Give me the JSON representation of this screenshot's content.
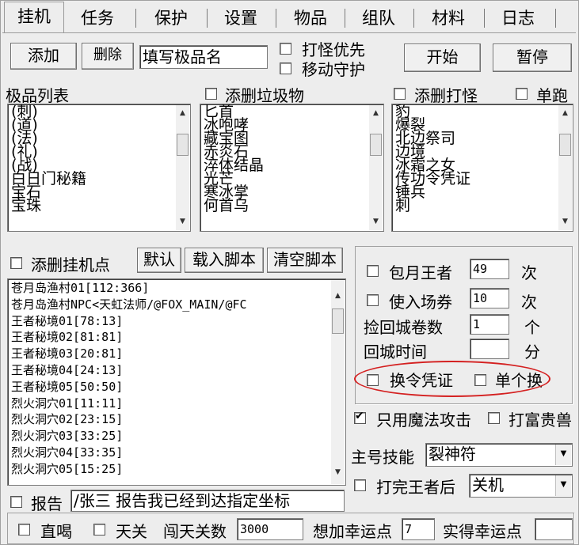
{
  "tabs": [
    "挂机",
    "任务",
    "保护",
    "设置",
    "物品",
    "组队",
    "材料",
    "日志"
  ],
  "toolbar": {
    "add_label": "添加",
    "delete_label": "删除",
    "item_name_value": "填写极品名",
    "monster_priority_label": "打怪优先",
    "move_protect_label": "移动守护",
    "start_label": "开始",
    "pause_label": "暂停"
  },
  "lists": {
    "best_title": "极品列表",
    "best_items": [
      "(刺)",
      "(道)",
      "(法)",
      "(礼)",
      "(战)",
      "白日门秘籍",
      "宝石",
      "宝珠"
    ],
    "junk_title": "添删垃圾物",
    "junk_items": [
      "匕首",
      "冰咆哮",
      "藏宝图",
      "赤炎石",
      "淬体结晶",
      "光芒",
      "寒冰掌",
      "何首乌"
    ],
    "monster_title": "添删打怪",
    "solo_label": "单跑",
    "monster_items": [
      "豹",
      "爆裂",
      "北边祭司",
      "边境",
      "冰霜之女",
      "传功令凭证",
      "锤兵",
      "刺"
    ]
  },
  "script": {
    "add_point_label": "添删挂机点",
    "default_label": "默认",
    "load_label": "载入脚本",
    "clear_label": "清空脚本",
    "points": [
      "苍月岛渔村01[112:366]",
      "苍月岛渔村NPC<天虹法师/@FOX_MAIN/@FC",
      "王者秘境01[78:13]",
      "王者秘境02[81:81]",
      "王者秘境03[20:81]",
      "王者秘境04[24:13]",
      "王者秘境05[50:50]",
      "烈火洞穴01[11:11]",
      "烈火洞穴02[23:15]",
      "烈火洞穴03[33:25]",
      "烈火洞穴04[33:35]",
      "烈火洞穴05[15:25]"
    ]
  },
  "options": {
    "monthly_king_label": "包月王者",
    "monthly_king_value": "49",
    "times_unit": "次",
    "use_ticket_label": "使入场券",
    "use_ticket_value": "10",
    "return_scroll_label": "捡回城卷数",
    "return_scroll_value": "1",
    "count_unit": "个",
    "return_time_label": "回城时间",
    "return_time_value": "",
    "minute_unit": "分",
    "swap_token_label": "换令凭证",
    "single_swap_label": "单个换",
    "magic_only_label": "只用魔法攻击",
    "fight_rich_label": "打富贵兽",
    "main_skill_label": "主号技能",
    "main_skill_value": "裂神符",
    "after_king_label": "打完王者后",
    "after_king_value": "关机"
  },
  "report": {
    "label": "报告",
    "value": "/张三 报告我已经到达指定坐标"
  },
  "bottom": {
    "drink_label": "直喝",
    "tianguan_label": "天关",
    "tianguan_count_label": "闯天关数",
    "tianguan_count_value": "3000",
    "luck_label": "想加幸运点",
    "luck_value": "7",
    "actual_luck_label": "实得幸运点",
    "actual_luck_value": ""
  },
  "colors": {
    "highlight_oval": "#d42020",
    "window_bg": "#ededed"
  }
}
